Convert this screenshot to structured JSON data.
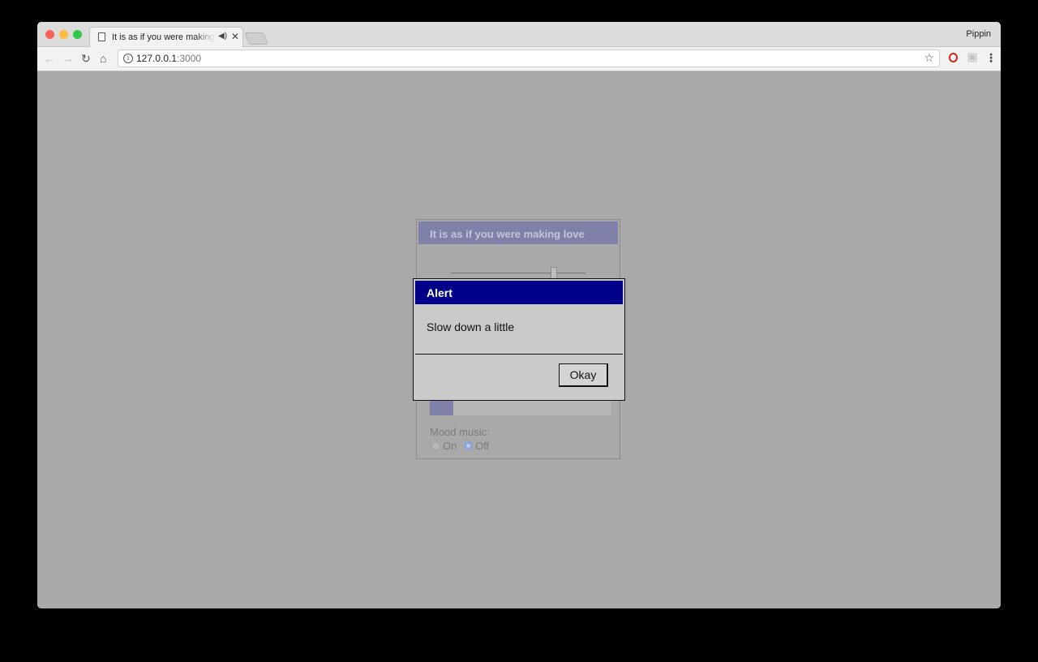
{
  "browser": {
    "tab_title": "It is as if you were making love",
    "profile_name": "Pippin",
    "url_host": "127.0.0.1",
    "url_port": ":3000",
    "icons": {
      "back": "arrow-left",
      "forward": "arrow-right",
      "reload": "reload",
      "home": "home",
      "info": "info-circle",
      "bookmark": "star",
      "tab_audio": "speaker",
      "tab_close": "close",
      "opera_extension": "opera-logo",
      "rss_extension": "rss",
      "menu": "vertical-dots"
    }
  },
  "app": {
    "title": "It is as if you were making love",
    "slider_value": 0.78,
    "progress_value": 0.13,
    "mood_label": "Mood music:",
    "radio_options": [
      {
        "label": "On",
        "selected": false
      },
      {
        "label": "Off",
        "selected": true
      }
    ],
    "colors": {
      "titlebar": "#7f81a8",
      "progress_fill": "#7f81a8"
    }
  },
  "alert": {
    "title": "Alert",
    "message": "Slow down a little",
    "button_label": "Okay",
    "colors": {
      "titlebar": "#000088"
    }
  }
}
